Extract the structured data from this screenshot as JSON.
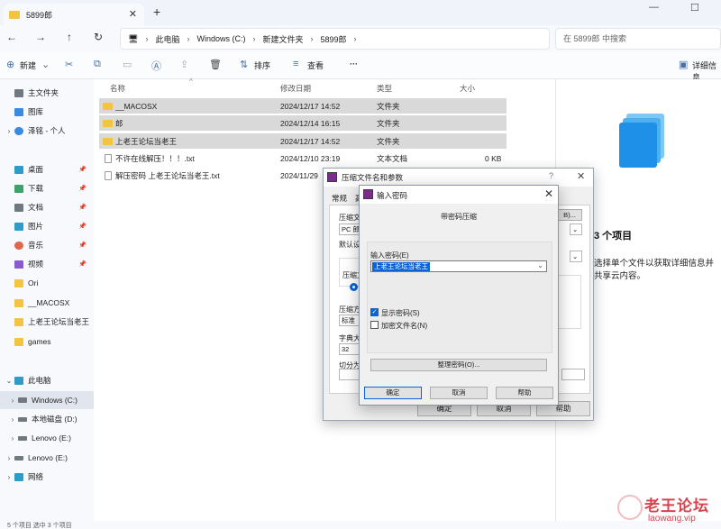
{
  "window": {
    "tab_title": "5899郎",
    "tab_close": "✕",
    "new_tab": "+",
    "minimize": "—",
    "maximize": "☐"
  },
  "nav": {
    "back": "←",
    "forward": "→",
    "up": "↑",
    "refresh": "↻",
    "breadcrumbs": [
      "此电脑",
      "Windows (C:)",
      "新建文件夹",
      "5899郎"
    ],
    "search_placeholder": "在 5899郎 中搜索"
  },
  "toolbar": {
    "new_label": "新建",
    "sort_label": "排序",
    "view_label": "查看",
    "more_label": "···",
    "details_label": "详细信息"
  },
  "sidebar": {
    "items": [
      {
        "label": "主文件夹"
      },
      {
        "label": "图库"
      },
      {
        "label": "泽铭 - 个人"
      },
      {
        "label": "桌面"
      },
      {
        "label": "下载"
      },
      {
        "label": "文档"
      },
      {
        "label": "图片"
      },
      {
        "label": "音乐"
      },
      {
        "label": "视频"
      },
      {
        "label": "Ori"
      },
      {
        "label": "__MACOSX"
      },
      {
        "label": "上老王论坛当老王"
      },
      {
        "label": "games"
      },
      {
        "label": "此电脑"
      },
      {
        "label": "Windows (C:)"
      },
      {
        "label": "本地磁盘 (D:)"
      },
      {
        "label": "Lenovo (E:)"
      },
      {
        "label": "Lenovo (E:)"
      },
      {
        "label": "网络"
      }
    ]
  },
  "filelist": {
    "columns": [
      "名称",
      "修改日期",
      "类型",
      "大小"
    ],
    "rows": [
      {
        "name": "__MACOSX",
        "date": "2024/12/17 14:52",
        "type": "文件夹",
        "size": ""
      },
      {
        "name": "郎",
        "date": "2024/12/14 16:15",
        "type": "文件夹",
        "size": ""
      },
      {
        "name": "上老王论坛当老王",
        "date": "2024/12/17 14:52",
        "type": "文件夹",
        "size": ""
      },
      {
        "name": "不许在线解压！！！.txt",
        "date": "2024/12/10 23:19",
        "type": "文本文档",
        "size": "0 KB"
      },
      {
        "name": "解压密码 上老王论坛当老王.txt",
        "date": "2024/11/29",
        "type": "",
        "size": ""
      }
    ]
  },
  "details": {
    "title": "3 个项目",
    "description": "选择单个文件以获取详细信息并共享云内容。"
  },
  "compress_dialog": {
    "title": "压缩文件名和参数",
    "help": "?",
    "close": "✕",
    "tabs": [
      "常规",
      "高"
    ],
    "archive_name_label": "压缩文件",
    "archive_name_value": "PC 郎.r",
    "browse_label": "B)...",
    "default_label": "默认设",
    "format_label": "压缩文",
    "method_label": "压缩方",
    "method_value": "标准",
    "dict_label": "字典大小",
    "dict_value": "32",
    "split_label": "切分为",
    "ok": "确定",
    "cancel": "取消",
    "help_btn": "帮助"
  },
  "password_dialog": {
    "title": "输入密码",
    "close": "✕",
    "heading": "带密码压缩",
    "password_label": "输入密码(E)",
    "password_value": "上老王论坛当老王",
    "show_password": "显示密码(S)",
    "show_password_checked": true,
    "encrypt_names": "加密文件名(N)",
    "encrypt_names_checked": false,
    "organize": "整理密码(O)...",
    "ok": "确定",
    "cancel": "取消",
    "help": "帮助"
  },
  "watermark": {
    "text_zh": "老王论坛",
    "text_en": "laowang.vip"
  },
  "status": {
    "text": "5 个项目  选中 3 个项目"
  },
  "colors": {
    "folder": "#f3c342",
    "accent": "#0a64d6",
    "watermark": "#d8434d"
  }
}
